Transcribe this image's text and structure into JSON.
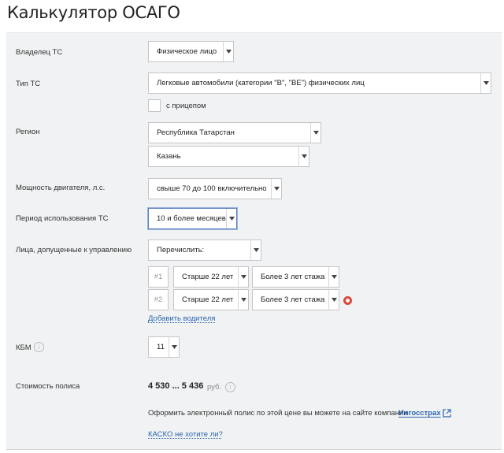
{
  "title": "Калькулятор ОСАГО",
  "owner": {
    "label": "Владелец ТС",
    "value": "Физическое лицо"
  },
  "vehicle_type": {
    "label": "Тип ТС",
    "value": "Легковые автомобили (категории \"B\", \"BE\") физических лиц",
    "trailer_label": "с прицепом"
  },
  "region": {
    "label": "Регион",
    "value": "Республика Татарстан",
    "city": "Казань"
  },
  "power": {
    "label": "Мощность двигателя, л.с.",
    "value": "свыше 70 до 100 включительно"
  },
  "period": {
    "label": "Период использования ТС",
    "value": "10 и более месяцев"
  },
  "drivers": {
    "label": "Лица, допущенные к управлению",
    "mode": "Перечислить:",
    "rows": [
      {
        "num": "#1",
        "age": "Старше 22 лет",
        "experience": "Более 3 лет стажа"
      },
      {
        "num": "#2",
        "age": "Старше 22 лет",
        "experience": "Более 3 лет стажа"
      }
    ],
    "add_label": "Добавить водителя"
  },
  "kbm": {
    "label": "КБМ",
    "value": "11",
    "info_icon": "i"
  },
  "cost": {
    "label": "Стоимость полиса",
    "value": "4 530 ... 5 436",
    "currency": "руб.",
    "info_icon": "i",
    "note": "Оформить электронный полис по этой цене вы можете на сайте компании",
    "company": "Ингосстрах",
    "kasko_link": "КАСКО не хотите ли?"
  },
  "icons": {
    "dropdown": "chevron-down-icon",
    "remove": "remove-icon",
    "external": "external-link-icon",
    "info": "info-icon"
  },
  "colors": {
    "link": "#2a66b0",
    "remove": "#d9473b",
    "panel": "#f1f2f3"
  }
}
